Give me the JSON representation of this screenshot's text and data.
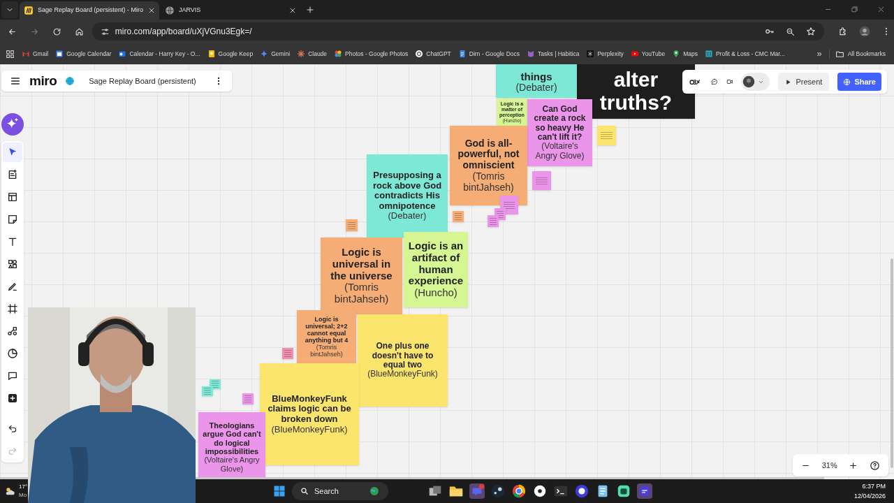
{
  "browser": {
    "tabs": [
      {
        "title": "Sage Replay Board (persistent) - Miro",
        "selected": true
      },
      {
        "title": "JARVIS",
        "selected": false
      }
    ],
    "url": "miro.com/app/board/uXjVGnu3Egk=/",
    "bookmarks": [
      "Gmail",
      "Google Calendar",
      "Calendar - Harry Key - O...",
      "Google Keep",
      "Gemini",
      "Claude",
      "Photos - Google Photos",
      "ChatGPT",
      "Dirn - Google Docs",
      "Tasks | Habitica",
      "Perplexity",
      "YouTube",
      "Maps",
      "Profit & Loss - CMC Mar..."
    ],
    "bookmarks_overflow": "»",
    "all_bookmarks": "All Bookmarks"
  },
  "board": {
    "logo": "miro",
    "title": "Sage Replay Board (persistent)",
    "present": "Present",
    "share": "Share",
    "tools": [
      {
        "selected": true
      },
      {
        "selected": false
      },
      {
        "selected": false
      },
      {
        "selected": false
      },
      {
        "selected": false
      },
      {
        "selected": false
      },
      {
        "selected": false
      },
      {
        "selected": false
      },
      {
        "selected": false
      },
      {
        "selected": false
      },
      {
        "selected": false
      },
      {
        "selected": false
      }
    ],
    "undo": {
      "disabled": false
    },
    "redo": {
      "disabled": true
    },
    "notes": [
      {
        "kind": "note",
        "color": "#7ee8d6",
        "text": "things",
        "author": "(Debater)"
      },
      {
        "kind": "note",
        "color": "#1e1e1e",
        "text": "alter truths?"
      },
      {
        "kind": "note",
        "color": "#d5f692",
        "text": "Logic is a matter of perception",
        "author": "(Huncho)"
      },
      {
        "kind": "note",
        "color": "#ea94ea",
        "text": "Can God create a rock so heavy He can't lift it?",
        "author": "(Voltaire's Angry Glove)"
      },
      {
        "kind": "mini",
        "color": "#fce56c"
      },
      {
        "kind": "note",
        "color": "#f5ad75",
        "text": "God is all-powerful, not omniscient",
        "author": "(Tomris bintJahseh)"
      },
      {
        "kind": "mini",
        "color": "#ea94ea"
      },
      {
        "kind": "mini",
        "color": "#ea94ea"
      },
      {
        "kind": "mini",
        "color": "#ea94ea"
      },
      {
        "kind": "mini",
        "color": "#ea94ea"
      },
      {
        "kind": "note",
        "color": "#7ee8d6",
        "text": "Presupposing a rock above God contradicts His omnipotence",
        "author": "(Debater)"
      },
      {
        "kind": "mini",
        "color": "#f5ad75"
      },
      {
        "kind": "mini",
        "color": "#f5ad75"
      },
      {
        "kind": "note",
        "color": "#f5ad75",
        "text": "Logic is universal in the universe",
        "author": "(Tomris bintJahseh)"
      },
      {
        "kind": "note",
        "color": "#d5f692",
        "text": "Logic is an artifact of human experience",
        "author": "(Huncho)"
      },
      {
        "kind": "note",
        "color": "#f5ad75",
        "text": "Logic is universal; 2+2 cannot equal anything but 4",
        "author": "(Tomris bintJahseh)"
      },
      {
        "kind": "note",
        "color": "#fce56c",
        "text": "One plus one doesn't have to equal two",
        "author": "(BlueMonkeyFunk)"
      },
      {
        "kind": "note",
        "color": "#fce56c",
        "text": "BlueMonkeyFunk claims logic can be broken down",
        "author": "(BlueMonkeyFunk)"
      },
      {
        "kind": "mini",
        "color": "#f08fae"
      },
      {
        "kind": "mini",
        "color": "#7ee8d6"
      },
      {
        "kind": "mini",
        "color": "#7ee8d6"
      },
      {
        "kind": "mini",
        "color": "#ea94ea"
      },
      {
        "kind": "note",
        "color": "#ea94ea",
        "text": "Theologians argue God can't do logical impossibilities",
        "author": "(Voltaire's Angry Glove)"
      }
    ],
    "zoom": "31%"
  },
  "taskbar": {
    "weather_temp": "17°",
    "weather_text": "Mo",
    "search": "Search",
    "time": "6:37 PM",
    "date": "12/04/2026"
  }
}
